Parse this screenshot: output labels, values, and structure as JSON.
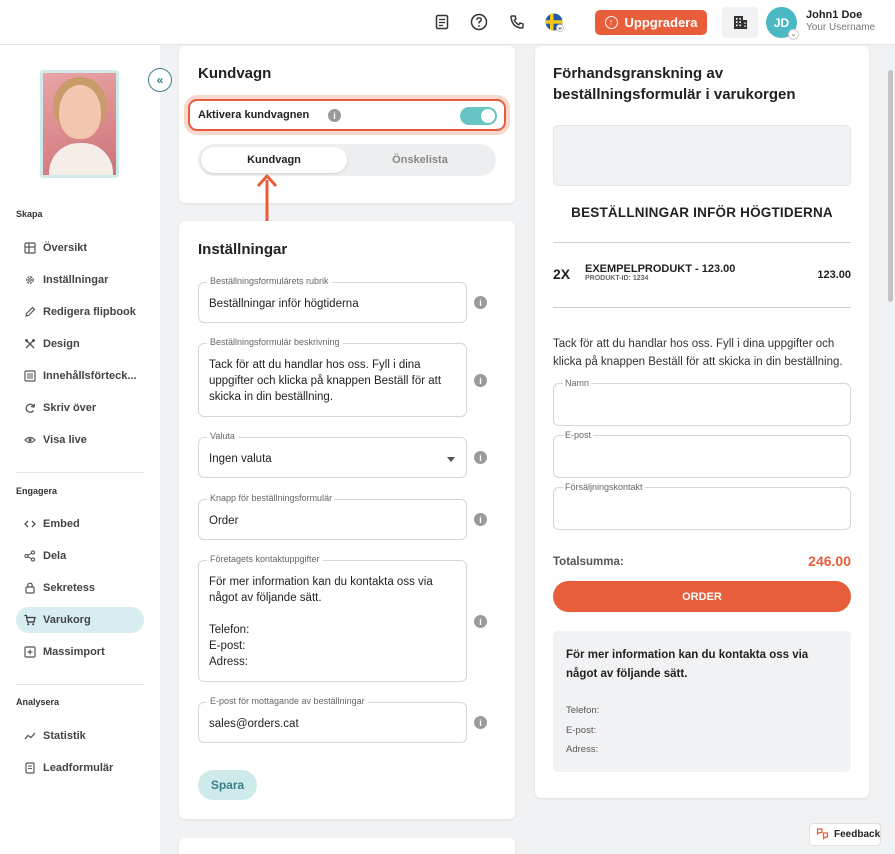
{
  "topbar": {
    "upgrade_label": "Uppgradera",
    "user_initials": "JD",
    "user_name": "John1 Doe",
    "user_sub": "Your Username"
  },
  "sidebar": {
    "sections": [
      {
        "title": "Skapa",
        "items": [
          "Översikt",
          "Inställningar",
          "Redigera flipbook",
          "Design",
          "Innehållsförteck...",
          "Skriv över",
          "Visa live"
        ]
      },
      {
        "title": "Engagera",
        "items": [
          "Embed",
          "Dela",
          "Sekretess",
          "Varukorg",
          "Massimport"
        ]
      },
      {
        "title": "Analysera",
        "items": [
          "Statistik",
          "Leadformulär"
        ]
      }
    ],
    "active_item": "Varukorg"
  },
  "cart_card": {
    "title": "Kundvagn",
    "activate_label": "Aktivera kundvagnen",
    "toggle_on": true,
    "tabs": [
      "Kundvagn",
      "Önskelista"
    ],
    "active_tab": "Kundvagn"
  },
  "settings": {
    "title": "Inställningar",
    "fields": [
      {
        "label": "Beställningsformulärets rubrik",
        "value": "Beställningar inför högtiderna"
      },
      {
        "label": "Beställningsformulär beskrivning",
        "value": "Tack för att du handlar hos oss. Fyll i dina uppgifter och klicka på knappen Beställ för att skicka in din beställning."
      },
      {
        "label": "Valuta",
        "value": "Ingen valuta"
      },
      {
        "label": "Knapp för beställningsformulär",
        "value": "Order"
      },
      {
        "label": "Företagets kontaktuppgifter",
        "value": "För mer information kan du kontakta oss via något av följande sätt.\n\nTelefon:\nE-post:\nAdress:"
      },
      {
        "label": "E-post för mottagande av beställningar",
        "value": "sales@orders.cat"
      }
    ],
    "save_label": "Spara"
  },
  "preview": {
    "title": "Förhandsgranskning av beställningsformulär i varukorgen",
    "heading": "BESTÄLLNINGAR INFÖR HÖGTIDERNA",
    "item_qty": "2X",
    "item_name": "EXEMPELPRODUKT -  123.00",
    "item_id": "PRODUKT-ID: 1234",
    "item_price": "123.00",
    "description": "Tack för att du handlar hos oss. Fyll i dina uppgifter och klicka på knappen Beställ för att skicka in din beställning.",
    "fields": [
      "Namn",
      "E-post",
      "Försäljningskontakt"
    ],
    "total_label": "Totalsumma:",
    "total_value": "246.00",
    "order_label": "ORDER",
    "contact_title": "För mer information kan du kontakta oss via något av följande sätt.",
    "contact_lines": [
      "Telefon:",
      "E-post:",
      "Adress:"
    ]
  },
  "feedback_label": "Feedback",
  "colors": {
    "accent": "#e85d3a",
    "teal": "#66c5c4",
    "active_bg": "#d6eef0"
  }
}
